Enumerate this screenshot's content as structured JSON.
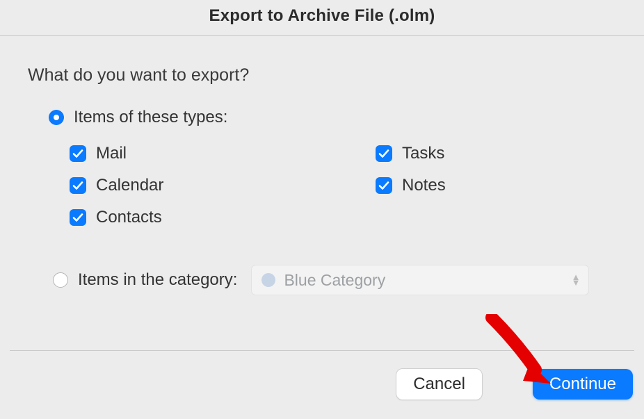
{
  "title": "Export to Archive File (.olm)",
  "question": "What do you want to export?",
  "option_types": {
    "label": "Items of these types:",
    "selected": true,
    "checks": {
      "mail": {
        "label": "Mail",
        "checked": true
      },
      "calendar": {
        "label": "Calendar",
        "checked": true
      },
      "contacts": {
        "label": "Contacts",
        "checked": true
      },
      "tasks": {
        "label": "Tasks",
        "checked": true
      },
      "notes": {
        "label": "Notes",
        "checked": true
      }
    }
  },
  "option_category": {
    "label": "Items in the category:",
    "selected": false,
    "selected_value": "Blue Category"
  },
  "buttons": {
    "cancel": "Cancel",
    "continue": "Continue"
  }
}
